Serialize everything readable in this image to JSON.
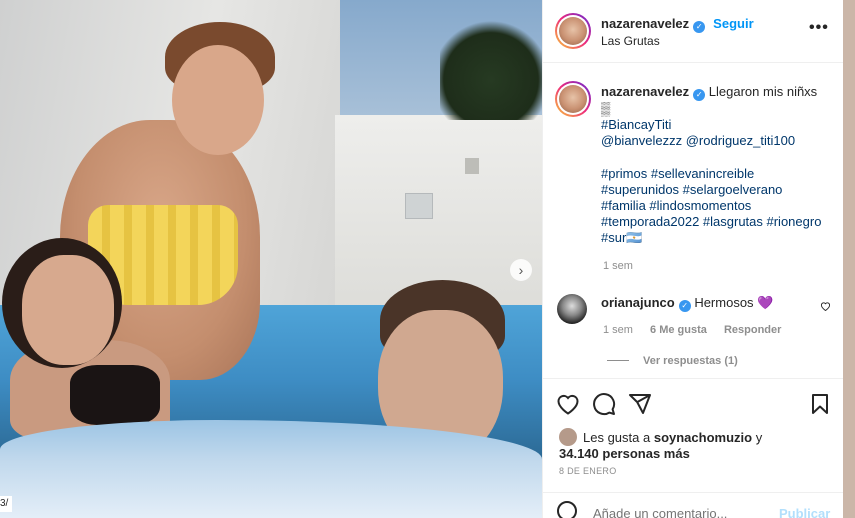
{
  "post": {
    "username": "nazarenavelez",
    "follow_label": "Seguir",
    "location": "Las Grutas",
    "more_label": "•••"
  },
  "caption": {
    "username": "nazarenavelez",
    "text": "Llegaron mis niñxs",
    "text_emoji": "▒",
    "hashtag_1": "#BiancayTiti",
    "mentions": "@bianvelezzz @rodriguez_titi100",
    "hashtags_line1": "#primos #sellevanincreible",
    "hashtags_line2": "#superunidos #selargoelverano",
    "hashtags_line3": "#familia #lindosmomentos",
    "hashtags_line4": "#temporada2022 #lasgrutas #rionegro",
    "hashtags_line5": "#sur",
    "flag": "🇦🇷",
    "time": "1 sem"
  },
  "comment": {
    "username": "orianajunco",
    "text": "Hermosos",
    "emoji": "💜",
    "time": "1 sem",
    "likes": "6 Me gusta",
    "reply_label": "Responder",
    "view_replies": "Ver respuestas (1)"
  },
  "likes": {
    "prefix": "Les gusta a",
    "user": "soynachomuzio",
    "conj": "y",
    "count": "34.140 personas más"
  },
  "date": "8 DE ENERO",
  "add_comment": {
    "placeholder": "Añade un comentario...",
    "publish": "Publicar"
  },
  "image": {
    "next_glyph": "›",
    "edge_label": "3/"
  },
  "colors": {
    "accent": "#0095f6",
    "verified": "#3897f0",
    "link": "#00376b",
    "muted": "#8e8e8e"
  }
}
